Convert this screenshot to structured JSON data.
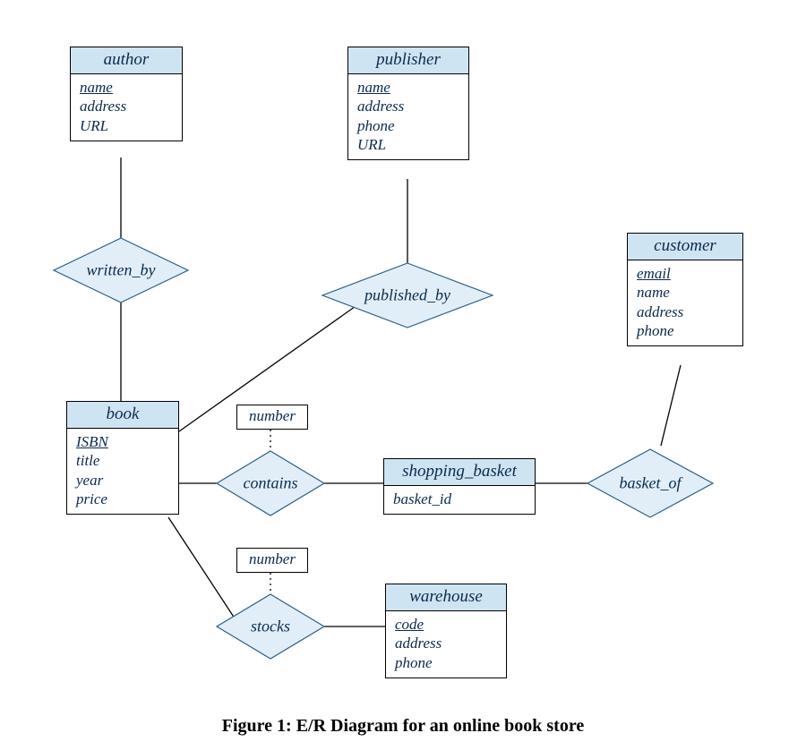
{
  "caption": "Figure 1: E/R Diagram for an online book store",
  "entities": {
    "author": {
      "title": "author",
      "attrs": [
        {
          "name": "name",
          "pk": true
        },
        {
          "name": "address"
        },
        {
          "name": "URL"
        }
      ]
    },
    "publisher": {
      "title": "publisher",
      "attrs": [
        {
          "name": "name",
          "pk": true
        },
        {
          "name": "address"
        },
        {
          "name": "phone"
        },
        {
          "name": "URL"
        }
      ]
    },
    "customer": {
      "title": "customer",
      "attrs": [
        {
          "name": "email",
          "pk": true
        },
        {
          "name": "name"
        },
        {
          "name": "address"
        },
        {
          "name": "phone"
        }
      ]
    },
    "book": {
      "title": "book",
      "attrs": [
        {
          "name": "ISBN",
          "pk": true
        },
        {
          "name": "title"
        },
        {
          "name": "year"
        },
        {
          "name": "price"
        }
      ]
    },
    "shopping_basket": {
      "title": "shopping_basket",
      "attrs": [
        {
          "name": "basket_id"
        }
      ]
    },
    "warehouse": {
      "title": "warehouse",
      "attrs": [
        {
          "name": "code",
          "pk": true
        },
        {
          "name": "address"
        },
        {
          "name": "phone"
        }
      ]
    }
  },
  "relations": {
    "written_by": {
      "label": "written_by"
    },
    "published_by": {
      "label": "published_by"
    },
    "contains": {
      "label": "contains"
    },
    "basket_of": {
      "label": "basket_of"
    },
    "stocks": {
      "label": "stocks"
    }
  },
  "rel_attrs": {
    "contains_number": "number",
    "stocks_number": "number"
  }
}
